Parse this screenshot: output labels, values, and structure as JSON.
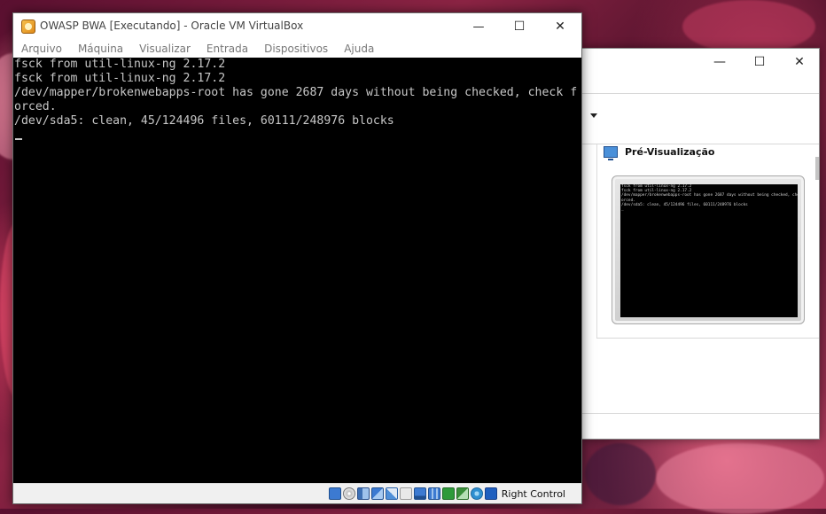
{
  "vm_window": {
    "title": "OWASP BWA [Executando] - Oracle VM VirtualBox",
    "controls": {
      "minimize": "—",
      "maximize": "☐",
      "close": "✕"
    },
    "menu": [
      "Arquivo",
      "Máquina",
      "Visualizar",
      "Entrada",
      "Dispositivos",
      "Ajuda"
    ],
    "console_lines": [
      "fsck from util-linux-ng 2.17.2",
      "fsck from util-linux-ng 2.17.2",
      "/dev/mapper/brokenwebapps-root has gone 2687 days without being checked, check f",
      "orced.",
      "/dev/sda5: clean, 45/124496 files, 60111/248976 blocks"
    ],
    "status_icons": [
      {
        "name": "hard-disk-icon",
        "color": "#3c7ad1"
      },
      {
        "name": "optical-drive-icon",
        "color": "#9a9a9a"
      },
      {
        "name": "audio-icon",
        "color": "#3d6fb4"
      },
      {
        "name": "network-icon",
        "color": "#3c7ad1"
      },
      {
        "name": "usb-icon",
        "color": "#4f8fd8"
      },
      {
        "name": "shared-folders-icon",
        "color": "#d9d9d9"
      },
      {
        "name": "display-icon",
        "color": "#3c7ad1"
      },
      {
        "name": "video-capture-icon",
        "color": "#3c7ad1"
      },
      {
        "name": "cpu-icon",
        "color": "#2e9a3a"
      },
      {
        "name": "virtualization-icon",
        "color": "#3a8f3a"
      },
      {
        "name": "mouse-integration-icon",
        "color": "#2e8fd1"
      },
      {
        "name": "keyboard-icon",
        "color": "#1f5fbf"
      }
    ],
    "host_key": "Right Control"
  },
  "manager_window": {
    "controls": {
      "minimize": "—",
      "maximize": "☐",
      "close": "✕"
    },
    "preview_title": "Pré-Visualização",
    "preview_lines": [
      "fsck from util-linux-ng 2.17.2",
      "fsck from util-linux-ng 2.17.2",
      "/dev/mapper/brokenwebapps-root has gone 2687 days without being checked, check f",
      "orced.",
      "/dev/sda5: clean, 45/124496 files, 60111/248976 blocks",
      "_"
    ]
  }
}
